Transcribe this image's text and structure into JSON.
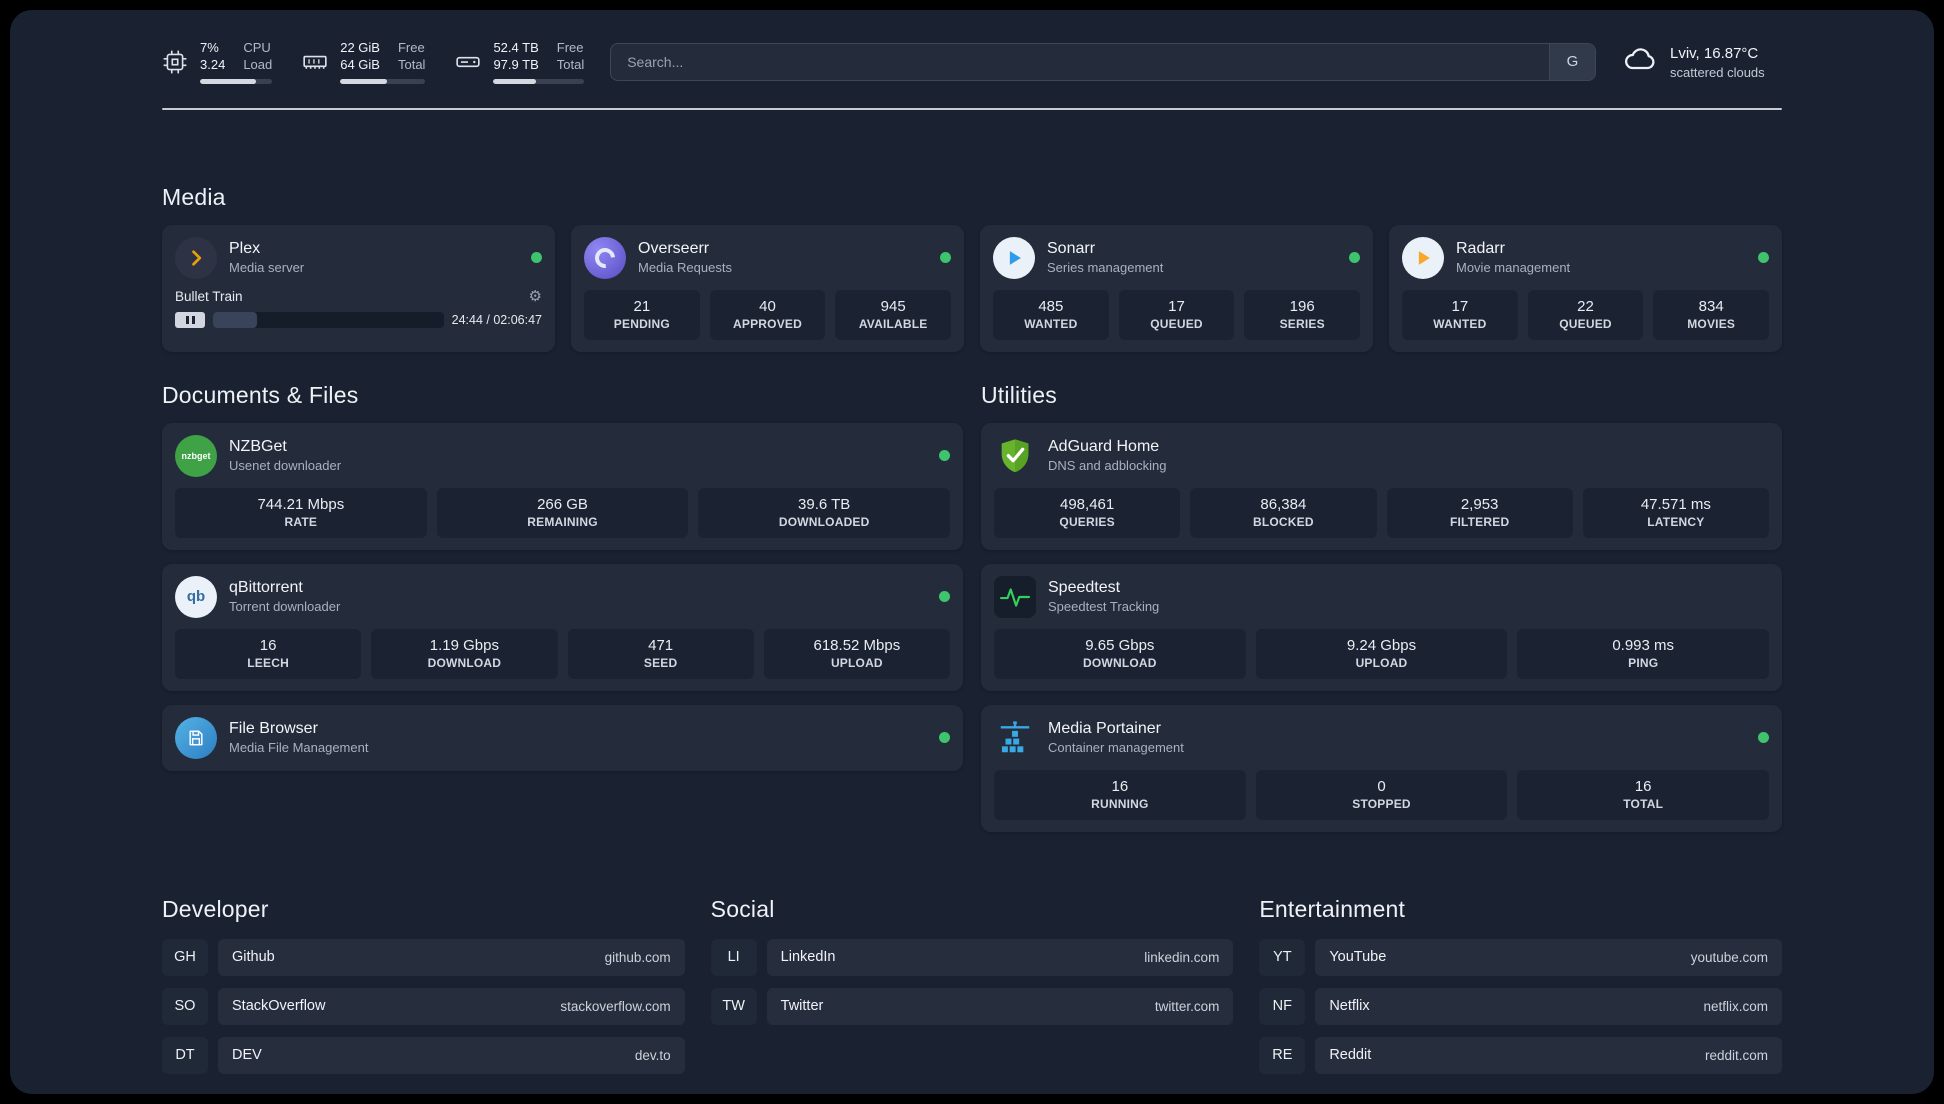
{
  "topbar": {
    "cpu": {
      "line1": "7%",
      "line2": "3.24",
      "label1": "CPU",
      "label2": "Load",
      "bar_percent": 78
    },
    "ram": {
      "line1": "22 GiB",
      "line2": "64 GiB",
      "label1": "Free",
      "label2": "Total",
      "bar_percent": 55
    },
    "disk": {
      "line1": "52.4 TB",
      "line2": "97.9 TB",
      "label1": "Free",
      "label2": "Total",
      "bar_percent": 47
    },
    "search": {
      "placeholder": "Search...",
      "button_label": "G"
    },
    "weather": {
      "location": "Lviv, 16.87°C",
      "condition": "scattered clouds"
    }
  },
  "sections": {
    "media": {
      "title": "Media",
      "plex": {
        "name": "Plex",
        "subtitle": "Media server",
        "now_playing": "Bullet Train",
        "time": "24:44 / 02:06:47",
        "progress_percent": 19
      },
      "overseerr": {
        "name": "Overseerr",
        "subtitle": "Media Requests",
        "stats": [
          {
            "value": "21",
            "label": "PENDING"
          },
          {
            "value": "40",
            "label": "APPROVED"
          },
          {
            "value": "945",
            "label": "AVAILABLE"
          }
        ]
      },
      "sonarr": {
        "name": "Sonarr",
        "subtitle": "Series management",
        "stats": [
          {
            "value": "485",
            "label": "WANTED"
          },
          {
            "value": "17",
            "label": "QUEUED"
          },
          {
            "value": "196",
            "label": "SERIES"
          }
        ]
      },
      "radarr": {
        "name": "Radarr",
        "subtitle": "Movie management",
        "stats": [
          {
            "value": "17",
            "label": "WANTED"
          },
          {
            "value": "22",
            "label": "QUEUED"
          },
          {
            "value": "834",
            "label": "MOVIES"
          }
        ]
      }
    },
    "documents": {
      "title": "Documents & Files",
      "nzbget": {
        "name": "NZBGet",
        "subtitle": "Usenet downloader",
        "icon_text": "nzbget",
        "stats": [
          {
            "value": "744.21 Mbps",
            "label": "RATE"
          },
          {
            "value": "266 GB",
            "label": "REMAINING"
          },
          {
            "value": "39.6 TB",
            "label": "DOWNLOADED"
          }
        ]
      },
      "qbittorrent": {
        "name": "qBittorrent",
        "subtitle": "Torrent downloader",
        "icon_text": "qb",
        "stats": [
          {
            "value": "16",
            "label": "LEECH"
          },
          {
            "value": "1.19 Gbps",
            "label": "DOWNLOAD"
          },
          {
            "value": "471",
            "label": "SEED"
          },
          {
            "value": "618.52 Mbps",
            "label": "UPLOAD"
          }
        ]
      },
      "filebrowser": {
        "name": "File Browser",
        "subtitle": "Media File Management"
      }
    },
    "utilities": {
      "title": "Utilities",
      "adguard": {
        "name": "AdGuard Home",
        "subtitle": "DNS and adblocking",
        "stats": [
          {
            "value": "498,461",
            "label": "QUERIES"
          },
          {
            "value": "86,384",
            "label": "BLOCKED"
          },
          {
            "value": "2,953",
            "label": "FILTERED"
          },
          {
            "value": "47.571 ms",
            "label": "LATENCY"
          }
        ]
      },
      "speedtest": {
        "name": "Speedtest",
        "subtitle": "Speedtest Tracking",
        "stats": [
          {
            "value": "9.65 Gbps",
            "label": "DOWNLOAD"
          },
          {
            "value": "9.24 Gbps",
            "label": "UPLOAD"
          },
          {
            "value": "0.993 ms",
            "label": "PING"
          }
        ]
      },
      "portainer": {
        "name": "Media Portainer",
        "subtitle": "Container management",
        "stats": [
          {
            "value": "16",
            "label": "RUNNING"
          },
          {
            "value": "0",
            "label": "STOPPED"
          },
          {
            "value": "16",
            "label": "TOTAL"
          }
        ]
      }
    },
    "developer": {
      "title": "Developer",
      "links": [
        {
          "abbr": "GH",
          "name": "Github",
          "url": "github.com"
        },
        {
          "abbr": "SO",
          "name": "StackOverflow",
          "url": "stackoverflow.com"
        },
        {
          "abbr": "DT",
          "name": "DEV",
          "url": "dev.to"
        }
      ]
    },
    "social": {
      "title": "Social",
      "links": [
        {
          "abbr": "LI",
          "name": "LinkedIn",
          "url": "linkedin.com"
        },
        {
          "abbr": "TW",
          "name": "Twitter",
          "url": "twitter.com"
        }
      ]
    },
    "entertainment": {
      "title": "Entertainment",
      "links": [
        {
          "abbr": "YT",
          "name": "YouTube",
          "url": "youtube.com"
        },
        {
          "abbr": "NF",
          "name": "Netflix",
          "url": "netflix.com"
        },
        {
          "abbr": "RE",
          "name": "Reddit",
          "url": "reddit.com"
        }
      ]
    }
  },
  "colors": {
    "status_green": "#3ec46d",
    "plex_amber": "#e5a00d",
    "sonarr_blue": "#2f9ceb",
    "radarr_amber": "#f7a829",
    "adguard_green": "#67b32e",
    "speedtest_green": "#34d05c",
    "portainer_blue": "#39a8e5"
  }
}
